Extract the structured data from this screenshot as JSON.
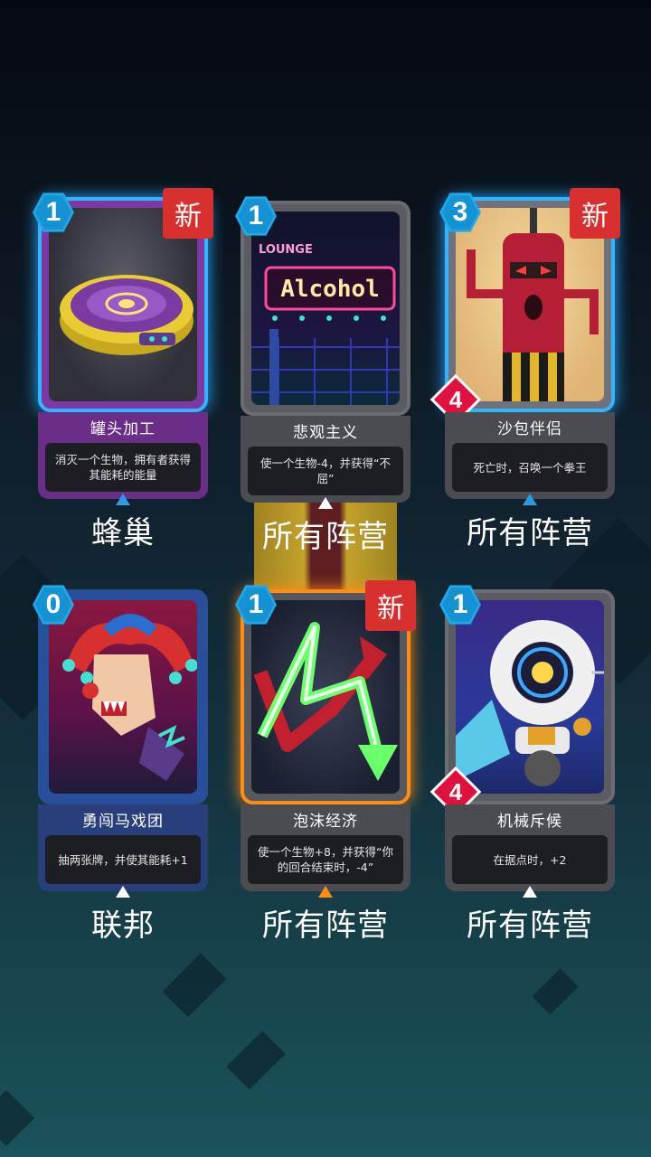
{
  "cards": [
    {
      "cost": "1",
      "title": "罐头加工",
      "desc": "消灭一个生物，拥有者获得其能耗的能量",
      "faction": "蜂巢",
      "is_new": true,
      "new_label": "新"
    },
    {
      "cost": "1",
      "title": "悲观主义",
      "desc": "使一个生物-4，并获得“不屈”",
      "faction": "所有阵营",
      "is_new": false,
      "sign_top": "LOUNGE",
      "sign_main": "Alcohol"
    },
    {
      "cost": "3",
      "title": "沙包伴侣",
      "desc": "死亡时，召唤一个拳王",
      "faction": "所有阵营",
      "is_new": true,
      "new_label": "新",
      "power": "4"
    },
    {
      "cost": "0",
      "title": "勇闯马戏团",
      "desc": "抽两张牌，并使其能耗+1",
      "faction": "联邦",
      "is_new": false
    },
    {
      "cost": "1",
      "title": "泡沫经济",
      "desc": "使一个生物+8，并获得“你的回合结束时，-4”",
      "faction": "所有阵营",
      "is_new": true,
      "new_label": "新"
    },
    {
      "cost": "1",
      "title": "机械斥候",
      "desc": "在据点时，+2",
      "faction": "所有阵营",
      "is_new": false,
      "power": "4"
    }
  ],
  "colors": {
    "arrow_blue": "#2b9ce0",
    "arrow_white": "#ffffff",
    "arrow_orange": "#ff8c14"
  }
}
